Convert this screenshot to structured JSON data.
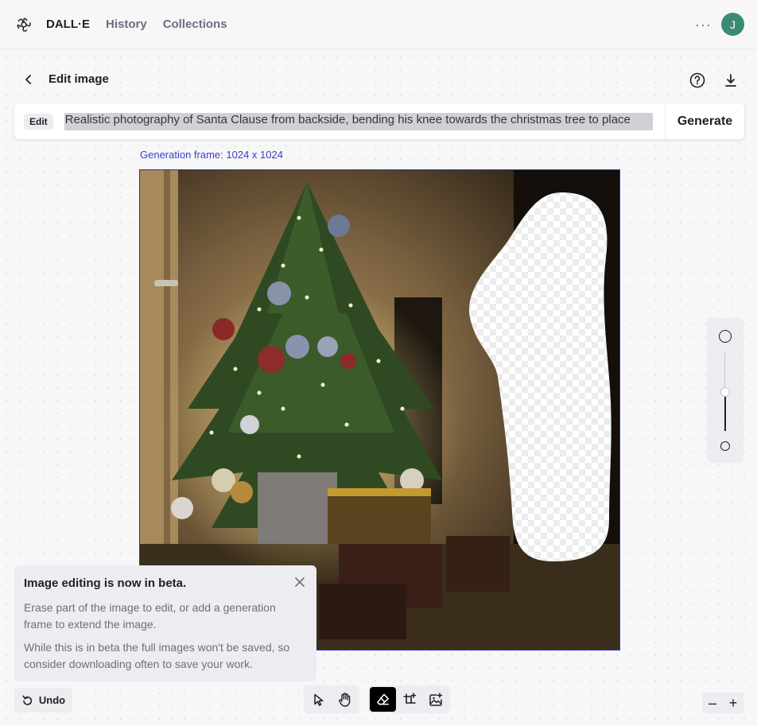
{
  "nav": {
    "brand": "DALL·E",
    "links": [
      "History",
      "Collections"
    ],
    "more": "···",
    "avatar_initial": "J"
  },
  "header": {
    "title": "Edit image"
  },
  "prompt": {
    "chip": "Edit",
    "value": "Realistic photography of Santa Clause from backside, bending his knee towards the christmas tree to place",
    "generate_label": "Generate"
  },
  "frame": {
    "label": "Generation frame: 1024 x 1024"
  },
  "brush_size": {
    "level_fraction": 0.5
  },
  "beta": {
    "title": "Image editing is now in beta.",
    "p1": "Erase part of the image to edit, or add a generation frame to extend the image.",
    "p2": "While this is in beta the full images won't be saved, so consider downloading often to save your work."
  },
  "toolbar": {
    "undo_label": "Undo",
    "active_tool": "eraser",
    "zoom_out": "–",
    "zoom_in": "+"
  },
  "colors": {
    "accent_frame": "#2a2ad0",
    "avatar": "#3b8a74"
  }
}
